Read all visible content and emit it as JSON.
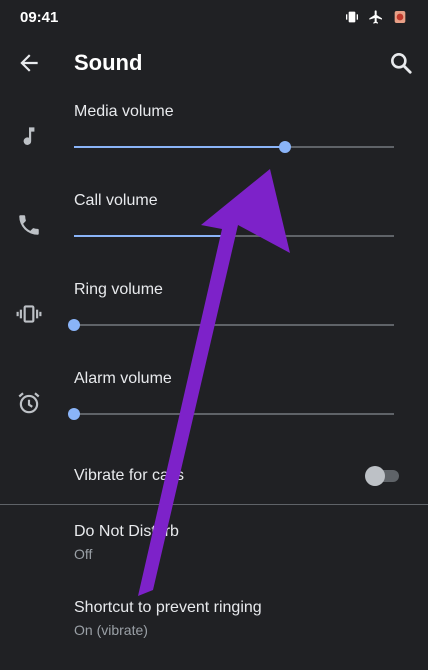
{
  "status_bar": {
    "time": "09:41",
    "icons": [
      "vibrate-icon",
      "airplane-icon",
      "notification-icon"
    ]
  },
  "app_bar": {
    "title": "Sound",
    "back_icon": "arrow-back-icon",
    "search_icon": "search-icon"
  },
  "volumes": [
    {
      "label": "Media volume",
      "icon": "music-note-icon",
      "level": 0.66
    },
    {
      "label": "Call volume",
      "icon": "phone-icon",
      "level": 0.47
    },
    {
      "label": "Ring volume",
      "icon": "vibrate-icon",
      "level": 0.0
    },
    {
      "label": "Alarm volume",
      "icon": "alarm-icon",
      "level": 0.0
    }
  ],
  "vibrate_for_calls": {
    "label": "Vibrate for calls",
    "enabled": false
  },
  "items": [
    {
      "title": "Do Not Disturb",
      "subtitle": "Off"
    },
    {
      "title": "Shortcut to prevent ringing",
      "subtitle": "On (vibrate)"
    }
  ],
  "colors": {
    "background": "#202124",
    "accent": "#8ab4f8",
    "annotation_arrow": "#7d22c9"
  }
}
